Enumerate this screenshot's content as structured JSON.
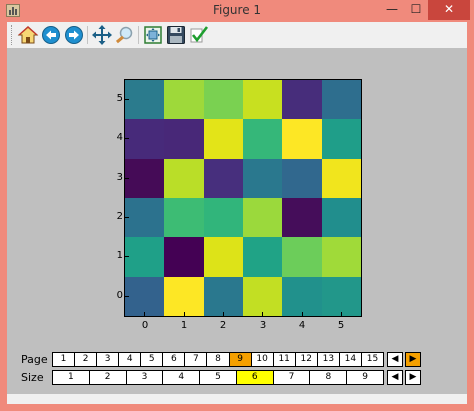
{
  "window": {
    "title": "Figure 1",
    "minimize_glyph": "—",
    "maximize_glyph": "☐",
    "close_glyph": "✕"
  },
  "toolbar": {
    "buttons": [
      {
        "name": "home-icon",
        "tooltip": "Home"
      },
      {
        "name": "back-icon",
        "tooltip": "Back"
      },
      {
        "name": "forward-icon",
        "tooltip": "Forward"
      },
      {
        "name": "pan-icon",
        "tooltip": "Pan"
      },
      {
        "name": "zoom-icon",
        "tooltip": "Zoom"
      },
      {
        "name": "subplots-icon",
        "tooltip": "Subplots"
      },
      {
        "name": "save-icon",
        "tooltip": "Save"
      },
      {
        "name": "edit-check-icon",
        "tooltip": "Edit"
      }
    ]
  },
  "heatmap": {
    "x_ticks": [
      "0",
      "1",
      "2",
      "3",
      "4",
      "5"
    ],
    "y_ticks": [
      "5",
      "4",
      "3",
      "2",
      "1",
      "0"
    ],
    "rows_top_to_bottom": [
      [
        "#2b7b8d",
        "#9ed93a",
        "#7ad151",
        "#c8e020",
        "#472d7b",
        "#2e6e8e"
      ],
      [
        "#472a7a",
        "#482878",
        "#e3e418",
        "#35b779",
        "#fde725",
        "#1f9e89"
      ],
      [
        "#450b57",
        "#bade28",
        "#472f7d",
        "#2a788e",
        "#31688e",
        "#f1e51d"
      ],
      [
        "#2c728e",
        "#3dbc74",
        "#31b57b",
        "#9bd93c",
        "#450d5a",
        "#218e8d"
      ],
      [
        "#1fa088",
        "#440154",
        "#dde318",
        "#20a386",
        "#6ccd5a",
        "#a0da39"
      ],
      [
        "#33628d",
        "#fde725",
        "#2a788e",
        "#c2df23",
        "#21918c",
        "#22978a"
      ]
    ]
  },
  "page_control": {
    "label": "Page",
    "items": [
      "1",
      "2",
      "3",
      "4",
      "5",
      "6",
      "7",
      "8",
      "9",
      "10",
      "11",
      "12",
      "13",
      "14",
      "15"
    ],
    "selected": "9",
    "selected_color": "#f5a000",
    "prev_glyph": "◀",
    "next_glyph": "▶"
  },
  "size_control": {
    "label": "Size",
    "items": [
      "1",
      "2",
      "3",
      "4",
      "5",
      "6",
      "7",
      "8",
      "9"
    ],
    "selected": "6",
    "selected_color": "#ffff00",
    "prev_glyph": "◀",
    "next_glyph": "▶"
  }
}
